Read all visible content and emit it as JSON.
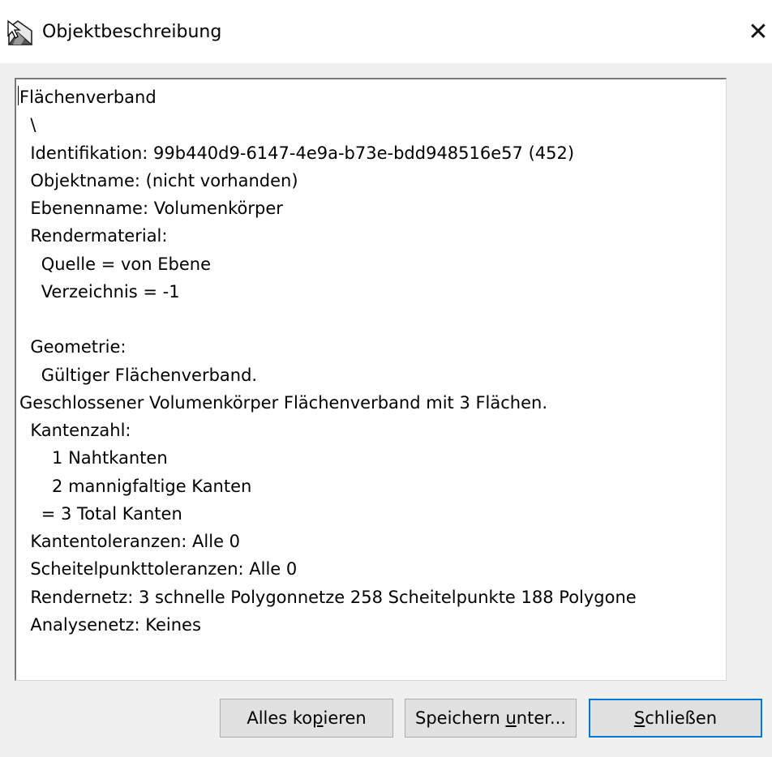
{
  "window": {
    "title": "Objektbeschreibung",
    "close_glyph": "✕",
    "app_icon": "rhino-object-icon"
  },
  "description": {
    "lines": [
      "Flächenverband",
      "  \\",
      "  Identifikation: 99b440d9-6147-4e9a-b73e-bdd948516e57 (452)",
      "  Objektname: (nicht vorhanden)",
      "  Ebenenname: Volumenkörper",
      "  Rendermaterial:",
      "    Quelle = von Ebene",
      "    Verzeichnis = -1",
      "",
      "  Geometrie:",
      "    Gültiger Flächenverband.",
      "Geschlossener Volumenkörper Flächenverband mit 3 Flächen.",
      "  Kantenzahl:",
      "      1 Nahtkanten",
      "      2 mannigfaltige Kanten",
      "    = 3 Total Kanten",
      "  Kantentoleranzen: Alle 0",
      "  Scheitelpunkttoleranzen: Alle 0",
      "  Rendernetz: 3 schnelle Polygonnetze 258 Scheitelpunkte 188 Polygone",
      "  Analysenetz: Keines"
    ]
  },
  "buttons": {
    "copy_all": {
      "before": "Alles ko",
      "accel": "p",
      "after": "ieren"
    },
    "save_as": {
      "before": "Speichern ",
      "accel": "u",
      "after": "nter..."
    },
    "close": {
      "before": "",
      "accel": "S",
      "after": "chließen"
    }
  },
  "colors": {
    "dialog_bg": "#f0f0f0",
    "default_button_border": "#0078d7"
  }
}
